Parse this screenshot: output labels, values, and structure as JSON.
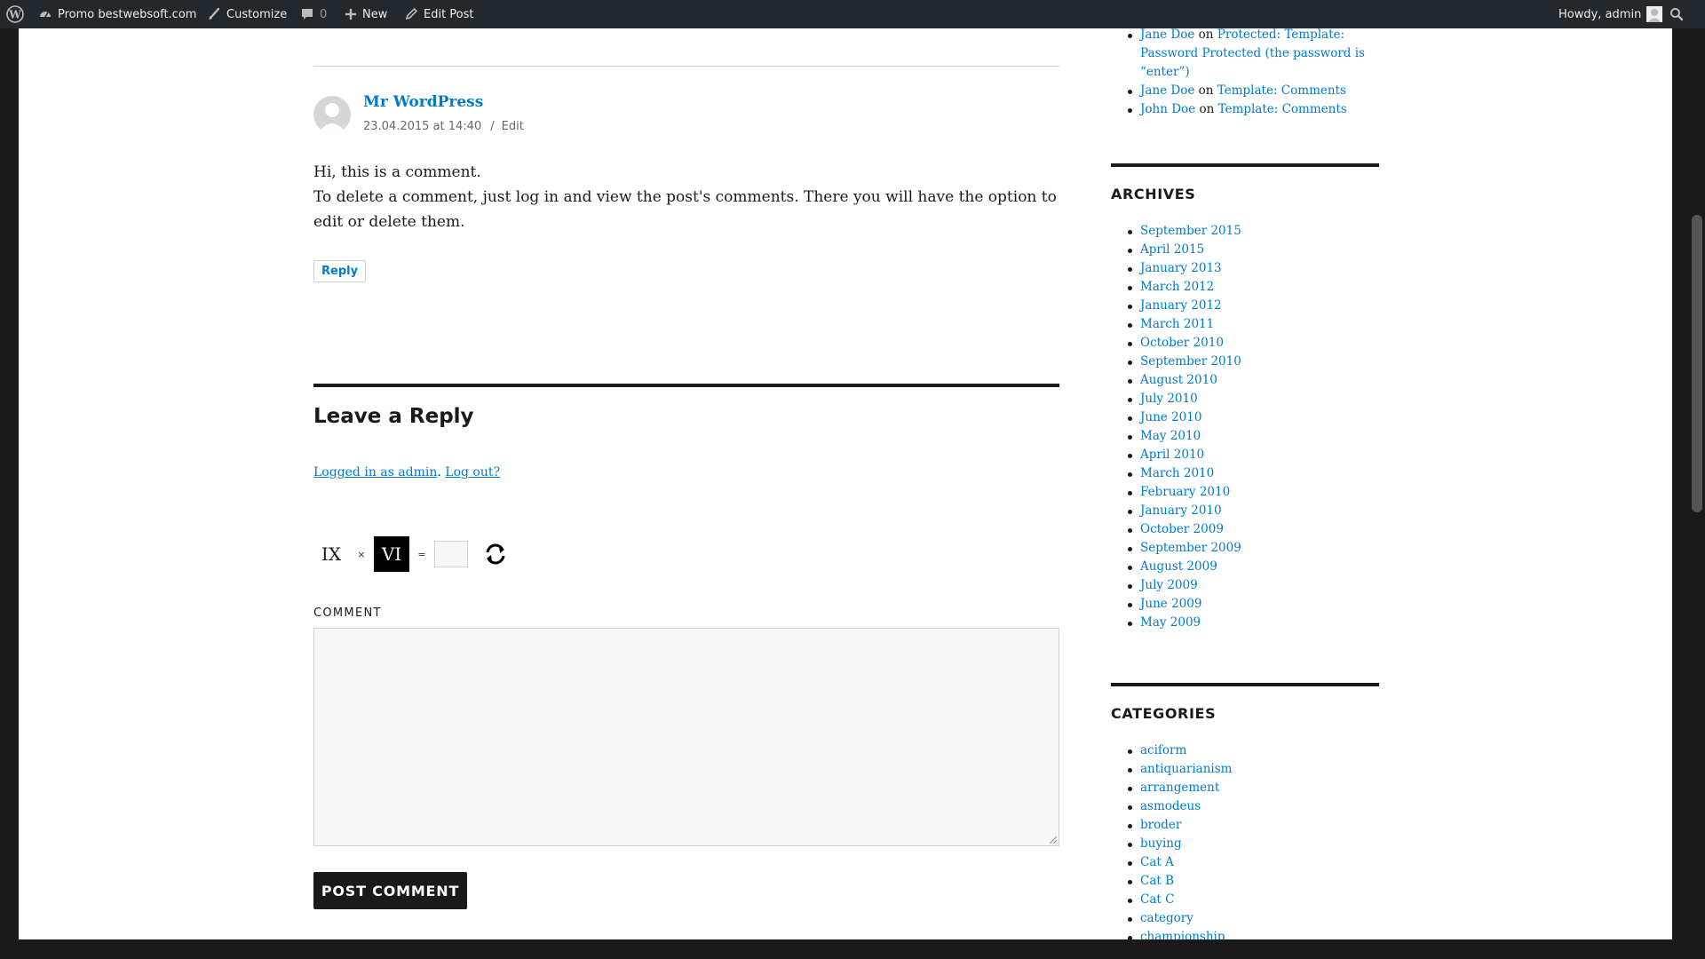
{
  "adminbar": {
    "site_name": "Promo bestwebsoft.com",
    "customize": "Customize",
    "comments_count": "0",
    "new": "New",
    "edit_post": "Edit Post",
    "howdy": "Howdy, admin"
  },
  "comment": {
    "author": "Mr WordPress",
    "date": "23.04.2015 at 14:40",
    "meta_separator": "/",
    "edit": "Edit",
    "line1": "Hi, this is a comment.",
    "line2": "To delete a comment, just log in and view the post's comments. There you will have the option to edit or delete them.",
    "reply": "Reply"
  },
  "reply_form": {
    "title": "Leave a Reply",
    "logged_in": "Logged in as admin",
    "separator": ".",
    "logout": "Log out?",
    "captcha_a": "IX",
    "captcha_op": "×",
    "captcha_b": "VI",
    "captcha_eq": "=",
    "comment_label": "COMMENT",
    "submit": "POST COMMENT"
  },
  "sidebar": {
    "recent_comments": [
      {
        "author": "Jane Doe",
        "on": "on",
        "post": "Protected: Template: Password Protected (the password is “enter”)"
      },
      {
        "author": "Jane Doe",
        "on": "on",
        "post": "Template: Comments"
      },
      {
        "author": "John Doe",
        "on": "on",
        "post": "Template: Comments"
      }
    ],
    "archives_title": "ARCHIVES",
    "archives": [
      "September 2015",
      "April 2015",
      "January 2013",
      "March 2012",
      "January 2012",
      "March 2011",
      "October 2010",
      "September 2010",
      "August 2010",
      "July 2010",
      "June 2010",
      "May 2010",
      "April 2010",
      "March 2010",
      "February 2010",
      "January 2010",
      "October 2009",
      "September 2009",
      "August 2009",
      "July 2009",
      "June 2009",
      "May 2009"
    ],
    "categories_title": "CATEGORIES",
    "categories": [
      "aciform",
      "antiquarianism",
      "arrangement",
      "asmodeus",
      "broder",
      "buying",
      "Cat A",
      "Cat B",
      "Cat C",
      "category",
      "championship"
    ]
  },
  "colors": {
    "link": "#007acc",
    "adminbar": "#23282d",
    "text": "#1a1a1a"
  }
}
